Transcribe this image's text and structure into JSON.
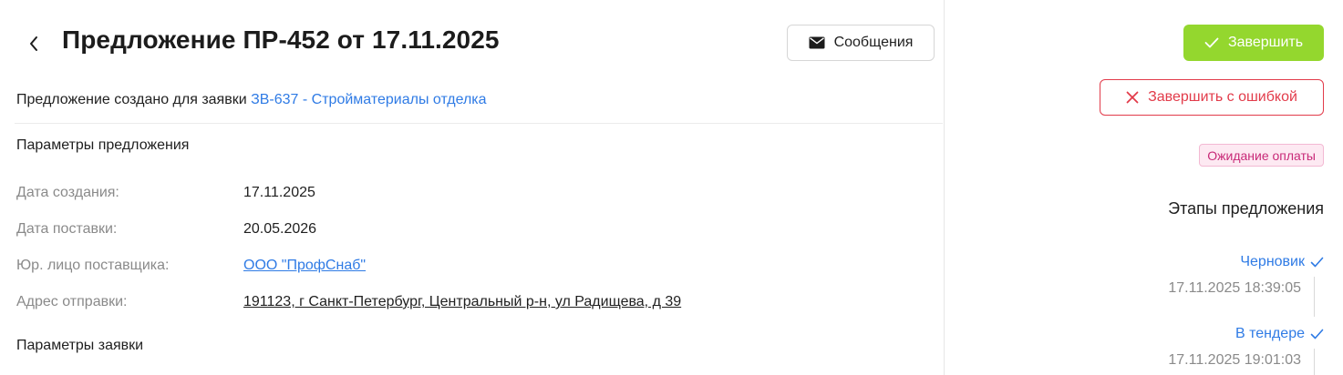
{
  "header": {
    "title": "Предложение ПР-452 от 17.11.2025",
    "messages_label": "Сообщения"
  },
  "created_for": {
    "prefix": "Предложение создано для заявки ",
    "link_text": "ЗВ-637 - Стройматериалы отделка"
  },
  "offer_params": {
    "section_title": "Параметры предложения",
    "rows": [
      {
        "label": "Дата создания:",
        "value": "17.11.2025"
      },
      {
        "label": "Дата поставки:",
        "value": "20.05.2026"
      },
      {
        "label": "Юр. лицо поставщика:",
        "value": "ООО \"ПрофСнаб\""
      },
      {
        "label": "Адрес отправки:",
        "value": "191123, г Санкт-Петербург, Центральный р-н, ул Радищева, д 39"
      }
    ]
  },
  "request_params": {
    "section_title": "Параметры заявки"
  },
  "actions": {
    "finish_label": "Завершить",
    "finish_error_label": "Завершить с ошибкой"
  },
  "status": {
    "label": "Ожидание оплаты"
  },
  "stages": {
    "title": "Этапы предложения",
    "items": [
      {
        "name": "Черновик",
        "date": "17.11.2025 18:39:05"
      },
      {
        "name": "В тендере",
        "date": "17.11.2025 19:01:03"
      }
    ]
  },
  "colors": {
    "link": "#2f7be5",
    "finish_button": "#94d72e",
    "error": "#e23b4a",
    "status_badge_bg": "#fde9f2",
    "status_badge_text": "#c82a78"
  },
  "icons": {
    "back": "chevron-left-icon",
    "messages": "envelope-icon",
    "finish": "check-icon",
    "finish_error": "close-icon",
    "stage_done": "check-icon"
  }
}
